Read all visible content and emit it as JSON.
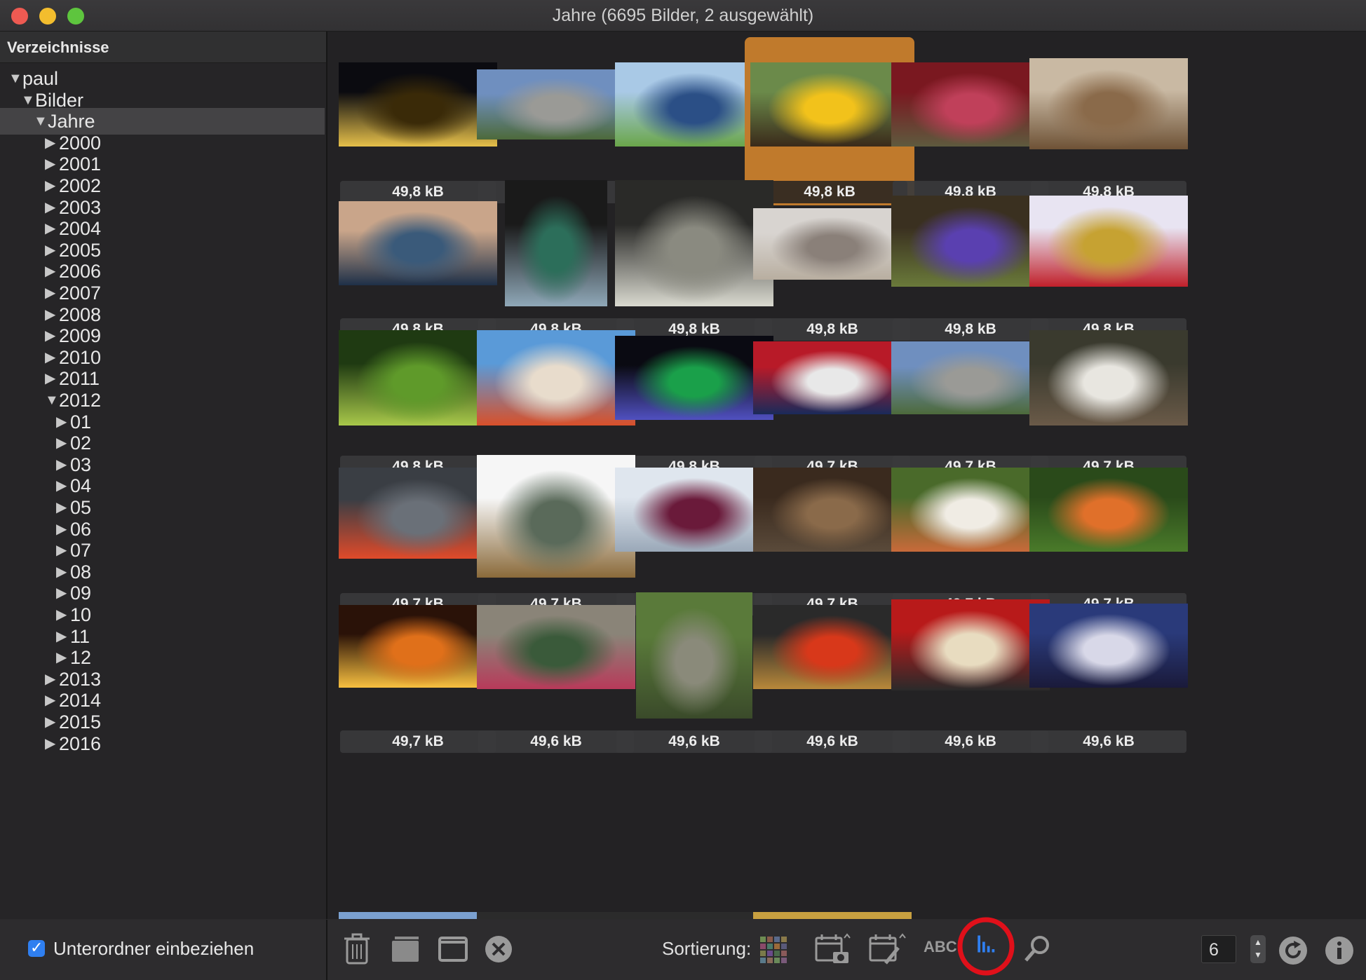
{
  "window": {
    "title": "Jahre (6695 Bilder, 2 ausgewählt)"
  },
  "sidebar": {
    "header": "Verzeichnisse",
    "tree": [
      {
        "label": "paul",
        "level": 0,
        "expanded": true
      },
      {
        "label": "Bilder",
        "level": 1,
        "expanded": true
      },
      {
        "label": "Jahre",
        "level": 2,
        "expanded": true,
        "selected": true
      },
      {
        "label": "2000",
        "level": 3,
        "expanded": false
      },
      {
        "label": "2001",
        "level": 3,
        "expanded": false
      },
      {
        "label": "2002",
        "level": 3,
        "expanded": false
      },
      {
        "label": "2003",
        "level": 3,
        "expanded": false
      },
      {
        "label": "2004",
        "level": 3,
        "expanded": false
      },
      {
        "label": "2005",
        "level": 3,
        "expanded": false
      },
      {
        "label": "2006",
        "level": 3,
        "expanded": false
      },
      {
        "label": "2007",
        "level": 3,
        "expanded": false
      },
      {
        "label": "2008",
        "level": 3,
        "expanded": false
      },
      {
        "label": "2009",
        "level": 3,
        "expanded": false
      },
      {
        "label": "2010",
        "level": 3,
        "expanded": false
      },
      {
        "label": "2011",
        "level": 3,
        "expanded": false
      },
      {
        "label": "2012",
        "level": 3,
        "expanded": true
      },
      {
        "label": "01",
        "level": 4,
        "expanded": false
      },
      {
        "label": "02",
        "level": 4,
        "expanded": false
      },
      {
        "label": "03",
        "level": 4,
        "expanded": false
      },
      {
        "label": "04",
        "level": 4,
        "expanded": false
      },
      {
        "label": "05",
        "level": 4,
        "expanded": false
      },
      {
        "label": "06",
        "level": 4,
        "expanded": false
      },
      {
        "label": "07",
        "level": 4,
        "expanded": false
      },
      {
        "label": "08",
        "level": 4,
        "expanded": false
      },
      {
        "label": "09",
        "level": 4,
        "expanded": false
      },
      {
        "label": "10",
        "level": 4,
        "expanded": false
      },
      {
        "label": "11",
        "level": 4,
        "expanded": false
      },
      {
        "label": "12",
        "level": 4,
        "expanded": false
      },
      {
        "label": "2013",
        "level": 3,
        "expanded": false
      },
      {
        "label": "2014",
        "level": 3,
        "expanded": false
      },
      {
        "label": "2015",
        "level": 3,
        "expanded": false
      },
      {
        "label": "2016",
        "level": 3,
        "expanded": false
      }
    ],
    "footer": {
      "checkbox_label": "Unterordner einbeziehen",
      "checked": true
    }
  },
  "grid": {
    "items": [
      {
        "subject": "stadium-night",
        "size": "49,8 kB",
        "colors": [
          "#0b0b10",
          "#3a2a08",
          "#e6c04a"
        ]
      },
      {
        "subject": "monument-rome",
        "size": "49,8 kB",
        "colors": [
          "#6f8fbf",
          "#9a9a96",
          "#4d6a3b"
        ]
      },
      {
        "subject": "football-players",
        "size": "49,8 kB",
        "colors": [
          "#a9c9e6",
          "#2b4f86",
          "#6aa64a"
        ]
      },
      {
        "subject": "sunflower",
        "size": "49,8 kB",
        "colors": [
          "#6b8a4a",
          "#f2c21b",
          "#3a2a1a"
        ],
        "selected": true
      },
      {
        "subject": "meat-cutting",
        "size": "49,8 kB",
        "colors": [
          "#7a1820",
          "#c0405a",
          "#5e5a3e"
        ]
      },
      {
        "subject": "desert-hills",
        "size": "49,8 kB",
        "colors": [
          "#c9b9a3",
          "#8a6a4a",
          "#6e5236"
        ]
      },
      {
        "subject": "sea-sunset-post",
        "size": "49,8 kB",
        "colors": [
          "#c9a58a",
          "#3a5a7a",
          "#1e3048"
        ]
      },
      {
        "subject": "fabrics",
        "size": "49,8 kB",
        "colors": [
          "#1a1a1a",
          "#2c6e5a",
          "#8fa8b8"
        ]
      },
      {
        "subject": "binoculars-drawing",
        "size": "49,8 kB",
        "colors": [
          "#2a2a28",
          "#8a8a80",
          "#dadad0"
        ]
      },
      {
        "subject": "elephant",
        "size": "49,8 kB",
        "colors": [
          "#d8d4d0",
          "#8a8079",
          "#b8aea0"
        ]
      },
      {
        "subject": "artichoke-flower",
        "size": "49,8 kB",
        "colors": [
          "#3a3020",
          "#5a40b0",
          "#6a7a3a"
        ]
      },
      {
        "subject": "shopping-cart",
        "size": "49,8 kB",
        "colors": [
          "#e8e4f2",
          "#c6a232",
          "#c0202a"
        ]
      },
      {
        "subject": "coffee-plant",
        "size": "49,8 kB",
        "colors": [
          "#1f3a12",
          "#5f9a2a",
          "#a8c84a"
        ]
      },
      {
        "subject": "beach-starfish",
        "size": "49,8 kB",
        "colors": [
          "#5a9ad8",
          "#e8dccc",
          "#d8502a"
        ]
      },
      {
        "subject": "night-boat",
        "size": "49,8 kB",
        "colors": [
          "#0a0a12",
          "#1aa04a",
          "#5050c0"
        ]
      },
      {
        "subject": "flag-bullets",
        "size": "49,7 kB",
        "colors": [
          "#b81a28",
          "#e8e8e8",
          "#1a2a5a"
        ]
      },
      {
        "subject": "monument-rome-2",
        "size": "49,7 kB",
        "colors": [
          "#6f8fbf",
          "#9a9a96",
          "#4d6a3b"
        ]
      },
      {
        "subject": "white-tiger",
        "size": "49,7 kB",
        "colors": [
          "#3a3a2e",
          "#e8e6e0",
          "#6a5a48"
        ]
      },
      {
        "subject": "keyboard-climber",
        "size": "49,7 kB",
        "colors": [
          "#3a3e44",
          "#6a7078",
          "#e04a2a"
        ]
      },
      {
        "subject": "yarn",
        "size": "49,7 kB",
        "colors": [
          "#f6f6f6",
          "#5a6a5a",
          "#8a6a3a"
        ]
      },
      {
        "subject": "child-sled",
        "size": "49,7 kB",
        "colors": [
          "#dfe6ee",
          "#6a1a3a",
          "#9aa8b8"
        ]
      },
      {
        "subject": "monkey-fence",
        "size": "49,7 kB",
        "colors": [
          "#3a2a1e",
          "#8a6a4a",
          "#5a4a3a"
        ]
      },
      {
        "subject": "salad-plate",
        "size": "49,7 kB",
        "colors": [
          "#4a6a2a",
          "#f0ece4",
          "#c86a3a"
        ]
      },
      {
        "subject": "orange-lilies",
        "size": "49,7 kB",
        "colors": [
          "#2a4a1a",
          "#e0702a",
          "#4a7a2a"
        ]
      },
      {
        "subject": "fire",
        "size": "49,7 kB",
        "colors": [
          "#2a1208",
          "#e0701a",
          "#f8c040"
        ]
      },
      {
        "subject": "wreath-city",
        "size": "49,6 kB",
        "colors": [
          "#8a8478",
          "#3a5a3a",
          "#b83a5a"
        ]
      },
      {
        "subject": "stone-tower",
        "size": "49,6 kB",
        "colors": [
          "#5a7a3a",
          "#8a8a7a",
          "#3a4a2a"
        ]
      },
      {
        "subject": "tomatoes-basket",
        "size": "49,6 kB",
        "colors": [
          "#2a2a2a",
          "#d8381a",
          "#b8883a"
        ]
      },
      {
        "subject": "ravioli-plate",
        "size": "49,6 kB",
        "colors": [
          "#b81a1a",
          "#e8dcc0",
          "#2a2a2a"
        ]
      },
      {
        "subject": "bridge-night",
        "size": "49,6 kB",
        "colors": [
          "#2a3a7a",
          "#d8d8e8",
          "#1a1a3a"
        ]
      }
    ]
  },
  "toolbar": {
    "sort_label": "Sortierung:",
    "count_value": "6",
    "sort_abc": "ABC",
    "accent": "#2f7ff0",
    "highlight": "#e0101a"
  }
}
